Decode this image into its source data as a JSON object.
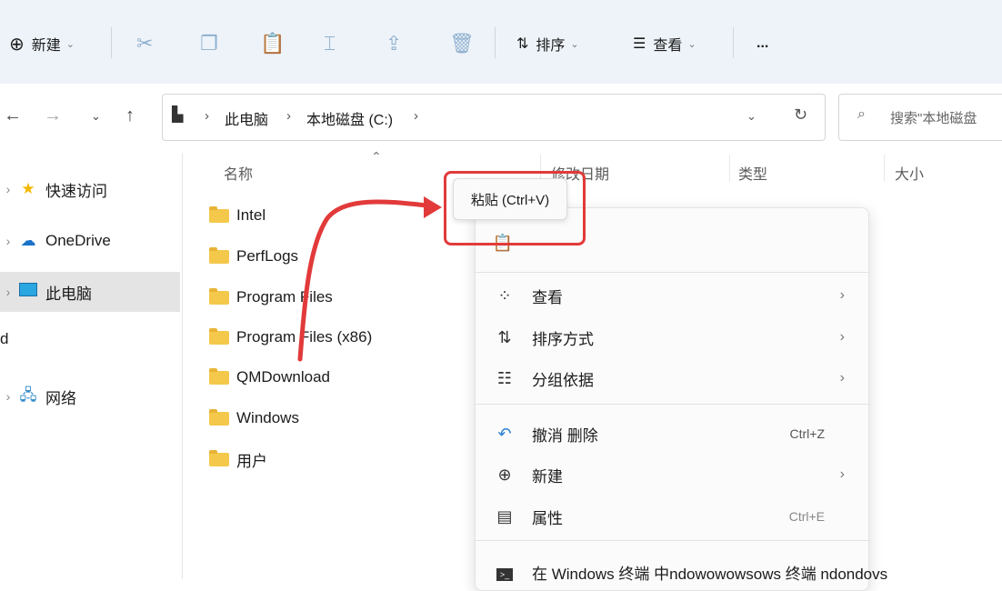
{
  "toolbar": {
    "new_label": "新建",
    "sort_label": "排序",
    "view_label": "查看",
    "more_label": "..."
  },
  "address": {
    "crumbs": [
      "此电脑",
      "本地磁盘 (C:)"
    ],
    "search_placeholder": "搜索\"本地磁盘"
  },
  "sidebar": {
    "items": [
      {
        "label": "快速访问"
      },
      {
        "label": "OneDrive"
      },
      {
        "label": "此电脑"
      },
      {
        "label": "d"
      },
      {
        "label": "网络"
      }
    ]
  },
  "columns": [
    "名称",
    "修改日期",
    "类型",
    "大小"
  ],
  "files": [
    "Intel",
    "PerfLogs",
    "Program Files",
    "Program Files (x86)",
    "QMDownload",
    "Windows",
    "用户"
  ],
  "tooltip": {
    "label": "粘贴 (Ctrl+V)"
  },
  "context_menu": {
    "items": [
      {
        "label": "查看",
        "shortcut": ""
      },
      {
        "label": "排序方式",
        "shortcut": ""
      },
      {
        "label": "分组依据",
        "shortcut": ""
      },
      {
        "label": "撤消 删除",
        "shortcut": "Ctrl+Z"
      },
      {
        "label": "新建",
        "shortcut": ""
      },
      {
        "label": "属性",
        "shortcut": "Ctrl+E"
      },
      {
        "label": "在 Windows 终端 中ndowowowsows 终端 ndondovs",
        "shortcut": ""
      }
    ]
  },
  "colors": {
    "accent": "#e23a3a",
    "folder": "#f4c84a",
    "toolbar_bg": "#eef3f9"
  }
}
